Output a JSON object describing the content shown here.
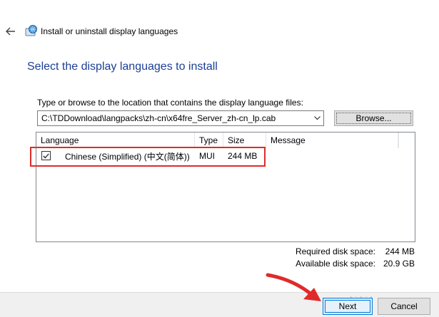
{
  "window": {
    "title": "Install or uninstall display languages"
  },
  "heading": "Select the display languages to install",
  "path": {
    "label": "Type or browse to the location that contains the display language files:",
    "value": "C:\\TDDownload\\langpacks\\zh-cn\\x64fre_Server_zh-cn_lp.cab",
    "browse_label": "Browse..."
  },
  "list": {
    "columns": [
      "Language",
      "Type",
      "Size",
      "Message"
    ],
    "rows": [
      {
        "checked": true,
        "language": "Chinese (Simplified) (中文(简体))",
        "type": "MUI",
        "size": "244 MB",
        "message": ""
      }
    ]
  },
  "disk": {
    "required_label": "Required disk space:",
    "required_value": "244 MB",
    "available_label": "Available disk space:",
    "available_value": "20.9 GB"
  },
  "buttons": {
    "next": "Next",
    "cancel": "Cancel"
  },
  "colors": {
    "heading": "#1c3f95",
    "annotation": "#e02a2a",
    "default_button_border": "#0078d7"
  }
}
